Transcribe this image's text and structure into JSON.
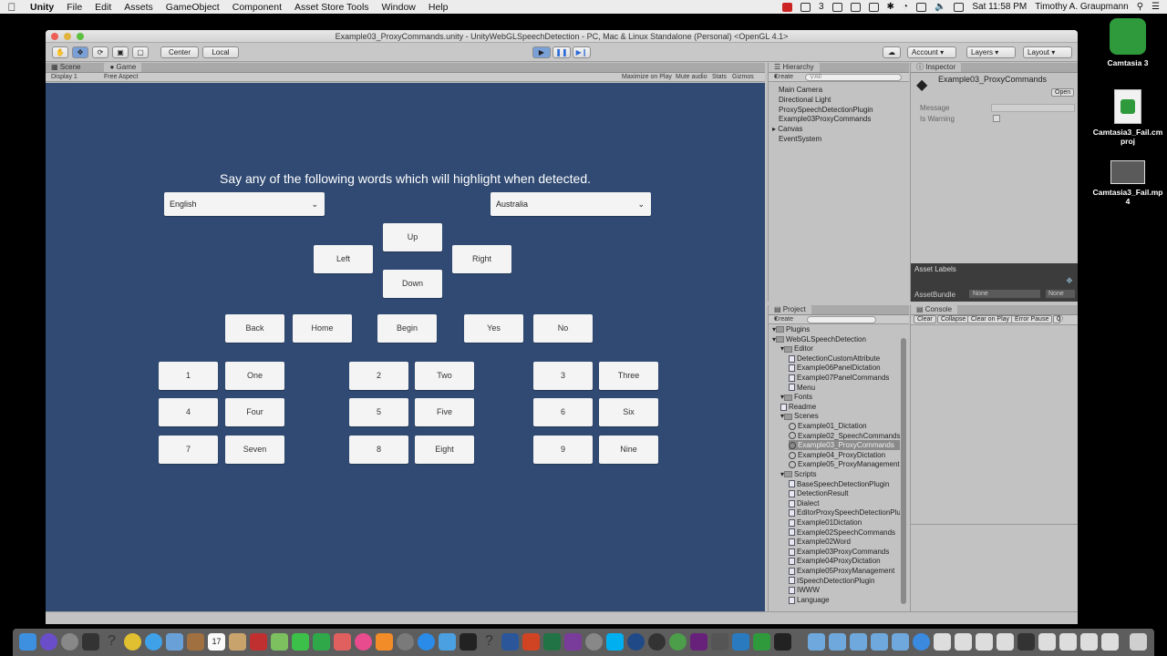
{
  "menubar": {
    "app": "Unity",
    "items": [
      "File",
      "Edit",
      "Assets",
      "GameObject",
      "Component",
      "Asset Store Tools",
      "Window",
      "Help"
    ],
    "tray_count": "3",
    "clock": "Sat 11:58 PM",
    "user": "Timothy A. Graupmann"
  },
  "desktop": {
    "icons": [
      {
        "label": "Camtasia 3"
      },
      {
        "label": "Camtasia3_Fail.cmproj"
      },
      {
        "label": "Camtasia3_Fail.mp4"
      }
    ]
  },
  "window": {
    "title": "Example03_ProxyCommands.unity - UnityWebGLSpeechDetection - PC, Mac & Linux Standalone (Personal) <OpenGL 4.1>"
  },
  "toolbar": {
    "pivot": "Center",
    "space": "Local",
    "account": "Account",
    "layers": "Layers",
    "layout": "Layout"
  },
  "scene_tabs": {
    "scene": "Scene",
    "game": "Game",
    "display": "Display 1",
    "aspect": "Free Aspect",
    "maximize": "Maximize on Play",
    "mute": "Mute audio",
    "stats": "Stats",
    "gizmos": "Gizmos"
  },
  "game": {
    "prompt": "Say any of the following words which will highlight when detected.",
    "language": "English",
    "dialect": "Australia",
    "dpad": {
      "up": "Up",
      "left": "Left",
      "right": "Right",
      "down": "Down"
    },
    "row_words": [
      "Back",
      "Home",
      "Begin",
      "Yes",
      "No"
    ],
    "numbers": [
      [
        "1",
        "One"
      ],
      [
        "2",
        "Two"
      ],
      [
        "3",
        "Three"
      ],
      [
        "4",
        "Four"
      ],
      [
        "5",
        "Five"
      ],
      [
        "6",
        "Six"
      ],
      [
        "7",
        "Seven"
      ],
      [
        "8",
        "Eight"
      ],
      [
        "9",
        "Nine"
      ]
    ]
  },
  "hierarchy": {
    "title": "Hierarchy",
    "create": "Create",
    "search_placeholder": "All",
    "items": [
      "Main Camera",
      "Directional Light",
      "ProxySpeechDetectionPlugin",
      "Example03ProxyCommands",
      "Canvas",
      "EventSystem"
    ]
  },
  "inspector": {
    "title": "Inspector",
    "object": "Example03_ProxyCommands",
    "open": "Open",
    "fields": [
      "Message",
      "Is Warning"
    ],
    "asset_labels": "Asset Labels",
    "asset_bundle": "AssetBundle",
    "bundle_value": "None",
    "variant_value": "None"
  },
  "project": {
    "title": "Project",
    "create": "Create",
    "items": [
      {
        "label": "Plugins",
        "depth": 0,
        "kind": "folder"
      },
      {
        "label": "WebGLSpeechDetection",
        "depth": 0,
        "kind": "folder"
      },
      {
        "label": "Editor",
        "depth": 1,
        "kind": "folder"
      },
      {
        "label": "DetectionCustomAttribute",
        "depth": 2,
        "kind": "script"
      },
      {
        "label": "Example06PanelDictation",
        "depth": 2,
        "kind": "script"
      },
      {
        "label": "Example07PanelCommands",
        "depth": 2,
        "kind": "script"
      },
      {
        "label": "Menu",
        "depth": 2,
        "kind": "script"
      },
      {
        "label": "Fonts",
        "depth": 1,
        "kind": "folder"
      },
      {
        "label": "Readme",
        "depth": 1,
        "kind": "script"
      },
      {
        "label": "Scenes",
        "depth": 1,
        "kind": "folder"
      },
      {
        "label": "Example01_Dictation",
        "depth": 2,
        "kind": "scene"
      },
      {
        "label": "Example02_SpeechCommands",
        "depth": 2,
        "kind": "scene"
      },
      {
        "label": "Example03_ProxyCommands",
        "depth": 2,
        "kind": "scene",
        "selected": true
      },
      {
        "label": "Example04_ProxyDictation",
        "depth": 2,
        "kind": "scene"
      },
      {
        "label": "Example05_ProxyManagement",
        "depth": 2,
        "kind": "scene"
      },
      {
        "label": "Scripts",
        "depth": 1,
        "kind": "folder"
      },
      {
        "label": "BaseSpeechDetectionPlugin",
        "depth": 2,
        "kind": "script"
      },
      {
        "label": "DetectionResult",
        "depth": 2,
        "kind": "script"
      },
      {
        "label": "Dialect",
        "depth": 2,
        "kind": "script"
      },
      {
        "label": "EditorProxySpeechDetectionPlugin",
        "depth": 2,
        "kind": "script"
      },
      {
        "label": "Example01Dictation",
        "depth": 2,
        "kind": "script"
      },
      {
        "label": "Example02SpeechCommands",
        "depth": 2,
        "kind": "script"
      },
      {
        "label": "Example02Word",
        "depth": 2,
        "kind": "script"
      },
      {
        "label": "Example03ProxyCommands",
        "depth": 2,
        "kind": "script"
      },
      {
        "label": "Example04ProxyDictation",
        "depth": 2,
        "kind": "script"
      },
      {
        "label": "Example05ProxyManagement",
        "depth": 2,
        "kind": "script"
      },
      {
        "label": "ISpeechDetectionPlugin",
        "depth": 2,
        "kind": "script"
      },
      {
        "label": "IWWW",
        "depth": 2,
        "kind": "script"
      },
      {
        "label": "Language",
        "depth": 2,
        "kind": "script"
      }
    ]
  },
  "console": {
    "title": "Console",
    "clear": "Clear",
    "collapse": "Collapse",
    "clear_on_play": "Clear on Play",
    "error_pause": "Error Pause",
    "count": "0"
  },
  "colors": {
    "game_bg": "#304a73",
    "button_bg": "#f4f4f4",
    "editor_bg": "#c2c2c2"
  }
}
